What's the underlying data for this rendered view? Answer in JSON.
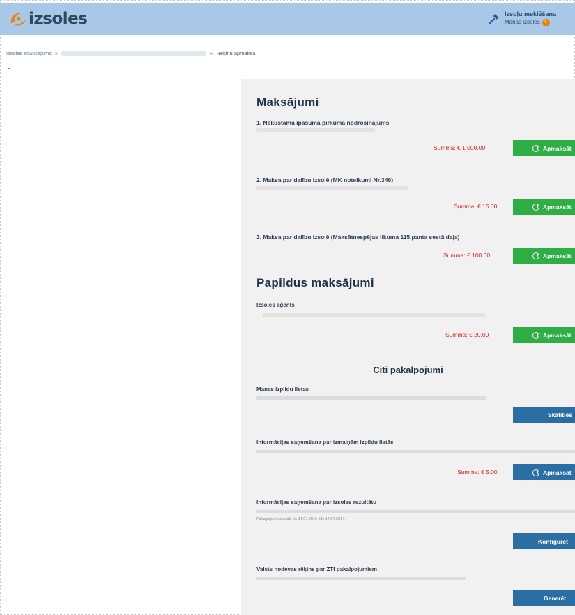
{
  "header": {
    "logo_text": "izsoles",
    "nav_title": "Izsoļu meklēšana",
    "nav_sub": "Manas izsoles",
    "badge_count": "1",
    "brand_color": "#e8830f"
  },
  "breadcrumb": {
    "first": "Izsoles skatīšajums",
    "sep": "»",
    "current": "Rēķinu apmaksa"
  },
  "payments": {
    "title": "Maksājumi",
    "items": [
      {
        "title": "1. Nekustamā īpašuma pirkuma nodrošinājums",
        "sum": "Summa: € 1 000.00",
        "button": "Apmaksāt"
      },
      {
        "title": "2. Maksa par dalību izsolē (MK noteikumi Nr.346)",
        "sum": "Summa: € 15.00",
        "button": "Apmaksāt"
      },
      {
        "title": "3. Maksa par dalību izsolē (Maksātnespējas likuma 115.panta sestā daļa)",
        "sum": "Summa: € 100.00",
        "button": "Apmaksāt"
      }
    ]
  },
  "extra": {
    "title": "Papildus maksājumi",
    "items": [
      {
        "title": "Izsoles aģents",
        "sum": "Summa: € 20.00",
        "button": "Apmaksāt"
      }
    ]
  },
  "other": {
    "title": "Citi pakalpojumi",
    "items": [
      {
        "title": "Manas izpildu lietas",
        "button": "Skatīties"
      },
      {
        "title": "Informācijas saņemšana par izmaiņām izpildu lietās",
        "sum": "Summa: € 5.00",
        "button": "Apmaksāt"
      },
      {
        "title": "Informācijas saņemšana par izsoles rezultātu",
        "desc2": "Pakalpojums aktuāls no 14.07.2016 līdz 14.07.2017.",
        "button": "Konfigurēt"
      },
      {
        "title": "Valsts nodevas rēķins par ZTI pakalpojumiem",
        "button": "Ģenerēt"
      }
    ]
  },
  "colors": {
    "green": "#2fae46",
    "blue": "#2b6ea4",
    "sum_red": "#e02424"
  }
}
